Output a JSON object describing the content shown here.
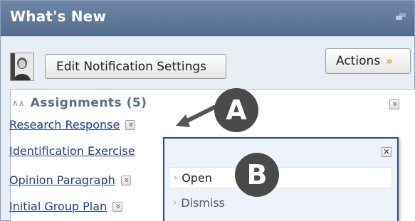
{
  "header": {
    "title": "What's New"
  },
  "toolbar": {
    "edit_settings_label": "Edit Notification Settings",
    "actions_label": "Actions"
  },
  "section": {
    "title": "Assignments (5)",
    "items": [
      {
        "label": "Research Response"
      },
      {
        "label": "Identification Exercise"
      },
      {
        "label": "Opinion Paragraph"
      },
      {
        "label": "Initial Group Plan"
      }
    ]
  },
  "context_menu": {
    "options": [
      {
        "label": "Open"
      },
      {
        "label": "Dismiss"
      }
    ]
  },
  "callouts": {
    "a": "A",
    "b": "B"
  },
  "colors": {
    "header_bg": "#5f7799",
    "link": "#1d3f8c",
    "popup_border": "#2e4d86",
    "callout_bg": "#4a4a4a",
    "actions_chevron": "#d89a16"
  }
}
